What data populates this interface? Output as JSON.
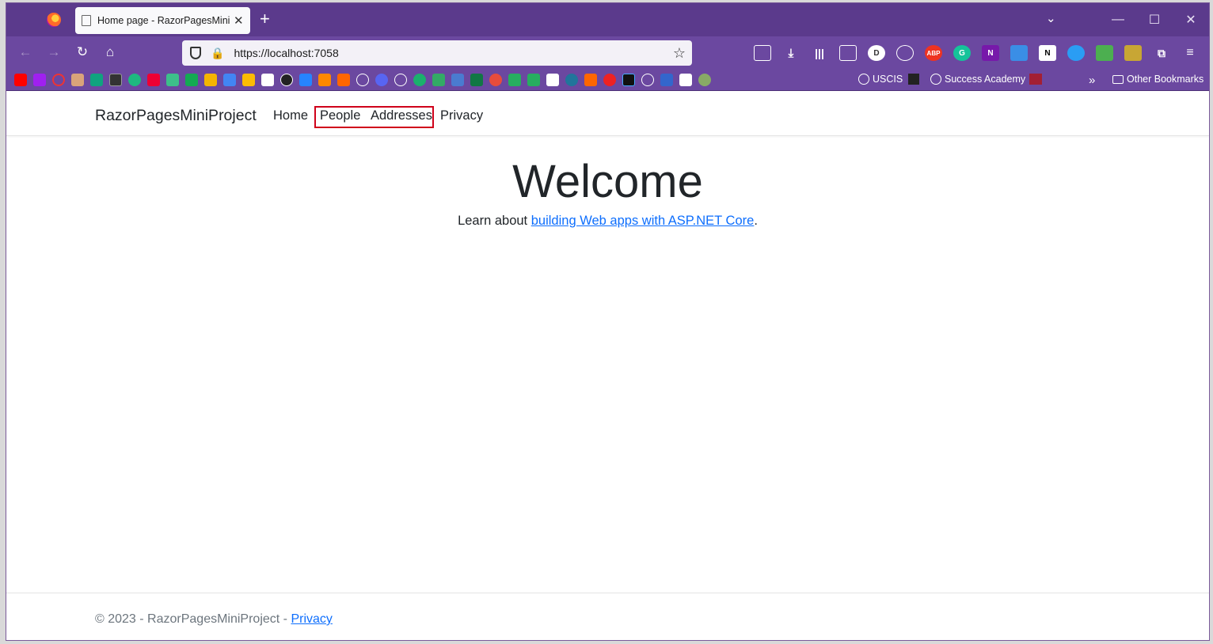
{
  "browser": {
    "tab_title": "Home page - RazorPagesMiniProject",
    "url": "https://localhost:7058",
    "bookmarks": {
      "uscis": "USCIS",
      "success_academy": "Success Academy",
      "other": "Other Bookmarks"
    }
  },
  "site": {
    "brand": "RazorPagesMiniProject",
    "nav": {
      "home": "Home",
      "people": "People",
      "addresses": "Addresses",
      "privacy": "Privacy"
    },
    "heading": "Welcome",
    "learn_prefix": "Learn about ",
    "learn_link": "building Web apps with ASP.NET Core",
    "learn_suffix": ".",
    "footer_text": "© 2023 - RazorPagesMiniProject - ",
    "footer_link": "Privacy"
  },
  "colors": {
    "browser_chrome": "#5b3a8c",
    "link": "#0d6efd",
    "highlight_box": "#d0021b"
  }
}
